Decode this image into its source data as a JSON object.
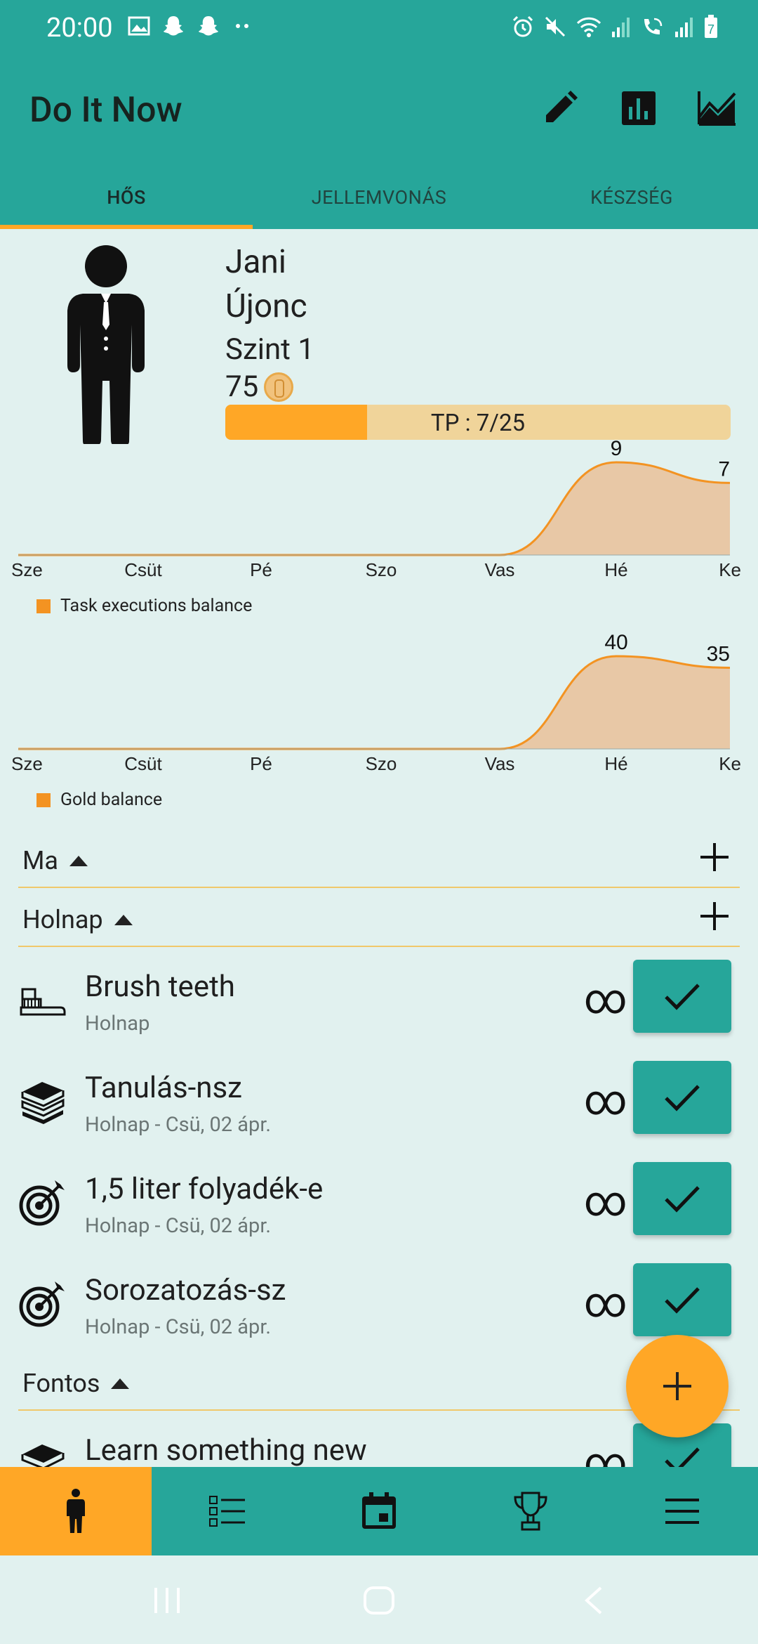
{
  "status_bar": {
    "time": "20:00",
    "battery_level": "7"
  },
  "app": {
    "title": "Do It Now"
  },
  "appbar_actions": [
    {
      "icon": "pencil-icon"
    },
    {
      "icon": "bar-chart-icon"
    },
    {
      "icon": "line-chart-icon"
    }
  ],
  "tabs": [
    {
      "label": "HŐS",
      "active": true
    },
    {
      "label": "JELLEMVONÁS",
      "active": false
    },
    {
      "label": "KÉSZSÉG",
      "active": false
    }
  ],
  "hero": {
    "name": "Jani",
    "rank": "Újonc",
    "level": "Szint 1",
    "gold": "75",
    "xp_label": "TP : 7/25",
    "xp_current": 7,
    "xp_max": 25
  },
  "chart_data": [
    {
      "type": "area",
      "x": [
        "Sze",
        "Csüt",
        "Pé",
        "Szo",
        "Vas",
        "Hé",
        "Ke"
      ],
      "series": [
        {
          "name": "Task executions balance",
          "values": [
            0,
            0,
            0,
            0,
            0,
            9,
            7
          ]
        }
      ],
      "data_labels": [
        "9",
        "7"
      ],
      "color": "#f39322",
      "fill": "#e8c8a6",
      "legend": "bottom-left"
    },
    {
      "type": "area",
      "x": [
        "Sze",
        "Csüt",
        "Pé",
        "Szo",
        "Vas",
        "Hé",
        "Ke"
      ],
      "series": [
        {
          "name": "Gold balance",
          "values": [
            0,
            0,
            0,
            0,
            0,
            40,
            35
          ]
        }
      ],
      "data_labels": [
        "40",
        "35"
      ],
      "color": "#f39322",
      "fill": "#e8c8a6",
      "legend": "bottom-left"
    }
  ],
  "sections": [
    {
      "label": "Ma"
    },
    {
      "label": "Holnap"
    },
    {
      "label": "Fontos"
    }
  ],
  "tasks": [
    {
      "name": "Brush teeth",
      "sub": "Holnap",
      "icon": "toothbrush-icon",
      "repeat": "∞"
    },
    {
      "name": "Tanulás-nsz",
      "sub": "Holnap - Csü, 02 ápr.",
      "icon": "books-icon",
      "repeat": "∞"
    },
    {
      "name": "1,5 liter folyadék-e",
      "sub": "Holnap - Csü, 02 ápr.",
      "icon": "target-icon",
      "repeat": "∞"
    },
    {
      "name": "Sorozatozás-sz",
      "sub": "Holnap - Csü, 02 ápr.",
      "icon": "target-icon",
      "repeat": "∞"
    },
    {
      "name": "Learn something new",
      "sub": "",
      "icon": "books-icon",
      "repeat": "∞"
    }
  ],
  "bottom_nav": [
    {
      "icon": "hero-icon",
      "active": true
    },
    {
      "icon": "checklist-icon",
      "active": false
    },
    {
      "icon": "calendar-icon",
      "active": false
    },
    {
      "icon": "trophy-icon",
      "active": false
    },
    {
      "icon": "menu-icon",
      "active": false
    }
  ]
}
